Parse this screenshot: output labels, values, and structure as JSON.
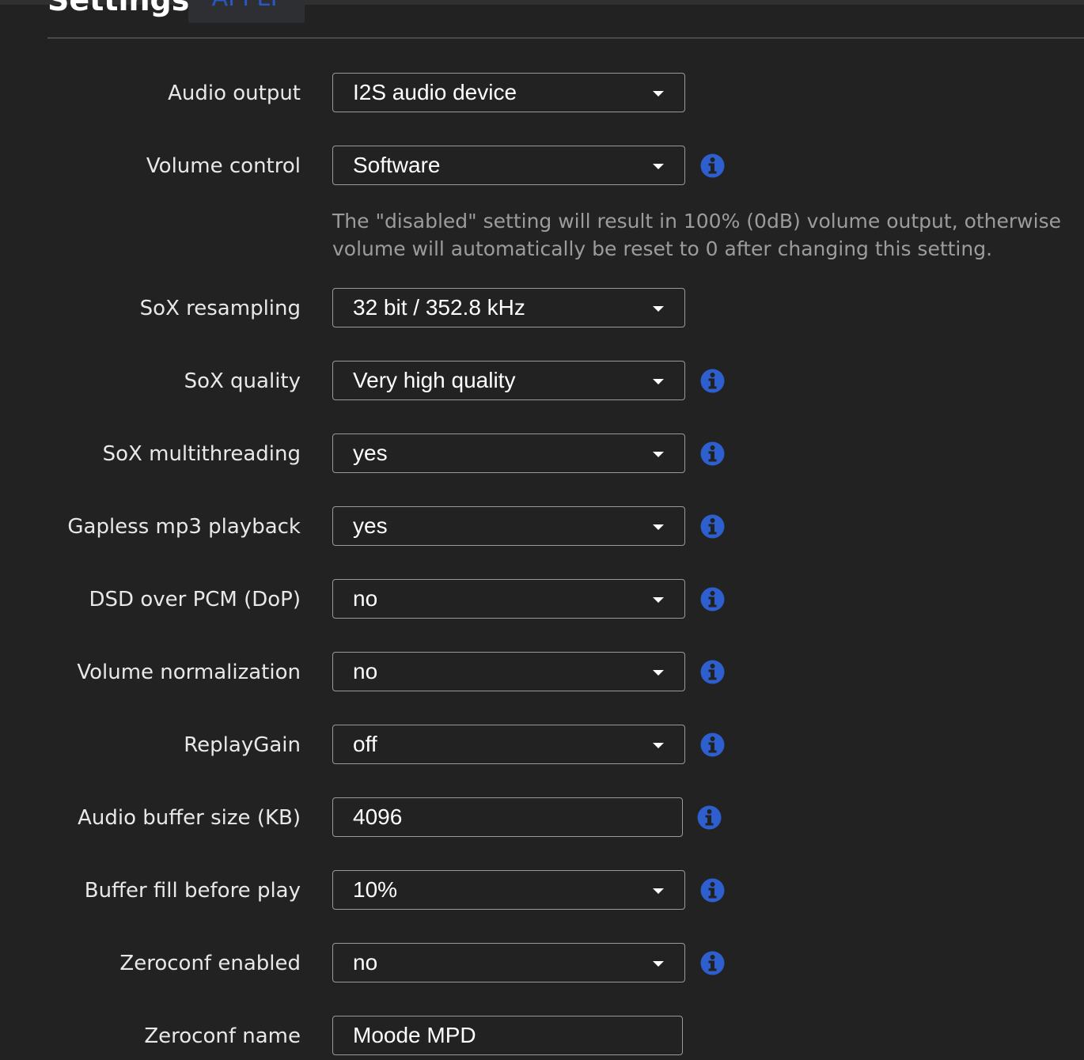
{
  "header": {
    "title": "Settings",
    "apply_label": "APPLY"
  },
  "rows": [
    {
      "label": "Audio output",
      "value": "I2S audio device",
      "type": "select",
      "info": false
    },
    {
      "label": "Volume control",
      "value": "Software",
      "type": "select",
      "info": true
    },
    {
      "label": "SoX resampling",
      "value": "32 bit / 352.8 kHz",
      "type": "select",
      "info": false
    },
    {
      "label": "SoX quality",
      "value": "Very high quality",
      "type": "select",
      "info": true
    },
    {
      "label": "SoX multithreading",
      "value": "yes",
      "type": "select",
      "info": true
    },
    {
      "label": "Gapless mp3 playback",
      "value": "yes",
      "type": "select",
      "info": true
    },
    {
      "label": "DSD over PCM (DoP)",
      "value": "no",
      "type": "select",
      "info": true
    },
    {
      "label": "Volume normalization",
      "value": "no",
      "type": "select",
      "info": true
    },
    {
      "label": "ReplayGain",
      "value": "off",
      "type": "select",
      "info": true
    },
    {
      "label": "Audio buffer size (KB)",
      "value": "4096",
      "type": "input",
      "info": true
    },
    {
      "label": "Buffer fill before play",
      "value": "10%",
      "type": "select",
      "info": true
    },
    {
      "label": "Zeroconf enabled",
      "value": "no",
      "type": "select",
      "info": true
    },
    {
      "label": "Zeroconf name",
      "value": "Moode MPD",
      "type": "input",
      "info": false
    }
  ],
  "volume_help": {
    "line1": "The \"disabled\" setting will result in 100% (0dB) volume output, otherwise",
    "line2": "volume will automatically be reset to 0 after changing this setting."
  },
  "colors": {
    "background": "#222222",
    "accent": "#2a56c6",
    "info_icon": "#2d5fcf"
  }
}
